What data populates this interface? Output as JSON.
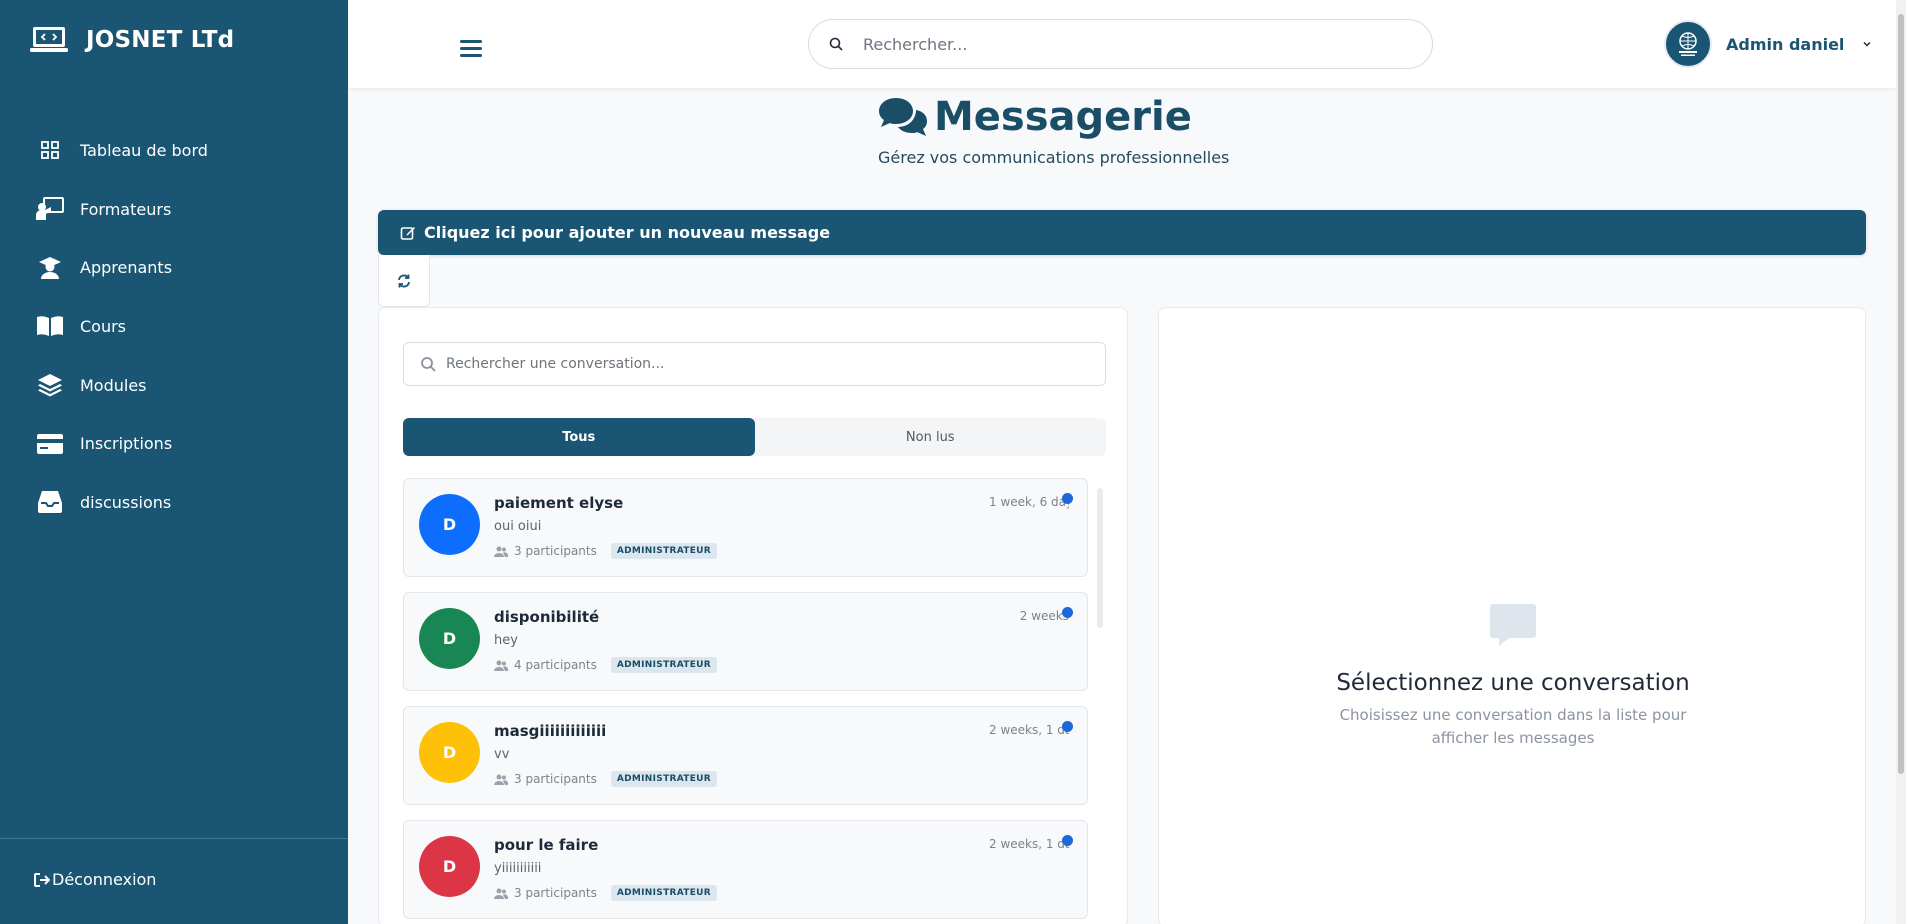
{
  "brand": {
    "name": "JOSNET LTd",
    "logo_icon": "laptop-code-icon"
  },
  "sidebar": {
    "items": [
      {
        "label": "Tableau de bord",
        "icon": "dashboard-icon"
      },
      {
        "label": "Formateurs",
        "icon": "chalkboard-teacher-icon"
      },
      {
        "label": "Apprenants",
        "icon": "graduate-icon"
      },
      {
        "label": "Cours",
        "icon": "book-open-icon"
      },
      {
        "label": "Modules",
        "icon": "layers-icon"
      },
      {
        "label": "Inscriptions",
        "icon": "credit-card-icon"
      },
      {
        "label": "discussions",
        "icon": "inbox-icon"
      }
    ],
    "logout_label": "Déconnexion"
  },
  "topbar": {
    "search_placeholder": "Rechercher...",
    "user_name": "Admin daniel"
  },
  "page": {
    "title": "Messagerie",
    "subtitle": "Gérez vos communications professionnelles",
    "new_message_label": "Cliquez ici pour ajouter un nouveau message"
  },
  "conversations": {
    "search_placeholder": "Rechercher une conversation...",
    "tabs": [
      {
        "label": "Tous"
      },
      {
        "label": "Non lus"
      }
    ],
    "active_tab": "Tous",
    "items": [
      {
        "initial": "D",
        "color": "#0d6efd",
        "title": "paiement elyse",
        "time": "1 week, 6 days",
        "preview": "oui oiui",
        "participants": "3 participants",
        "role": "ADMINISTRATEUR",
        "unread": true
      },
      {
        "initial": "D",
        "color": "#198754",
        "title": "disponibilité",
        "time": "2 weeks",
        "preview": "hey",
        "participants": "4 participants",
        "role": "ADMINISTRATEUR",
        "unread": true
      },
      {
        "initial": "D",
        "color": "#ffc107",
        "title": "masgiiiiiiiiiiiii",
        "time": "2 weeks, 1 day",
        "preview": "vv",
        "participants": "3 participants",
        "role": "ADMINISTRATEUR",
        "unread": true
      },
      {
        "initial": "D",
        "color": "#dc3545",
        "title": "pour le faire",
        "time": "2 weeks, 1 day",
        "preview": "yiiiiiiiiiii",
        "participants": "3 participants",
        "role": "ADMINISTRATEUR",
        "unread": true
      }
    ]
  },
  "empty_state": {
    "title": "Sélectionnez une conversation",
    "subtitle": "Choisissez une conversation dans la liste pour afficher les messages"
  },
  "colors": {
    "primary": "#1a5673",
    "unread_dot": "#1e66d9"
  }
}
